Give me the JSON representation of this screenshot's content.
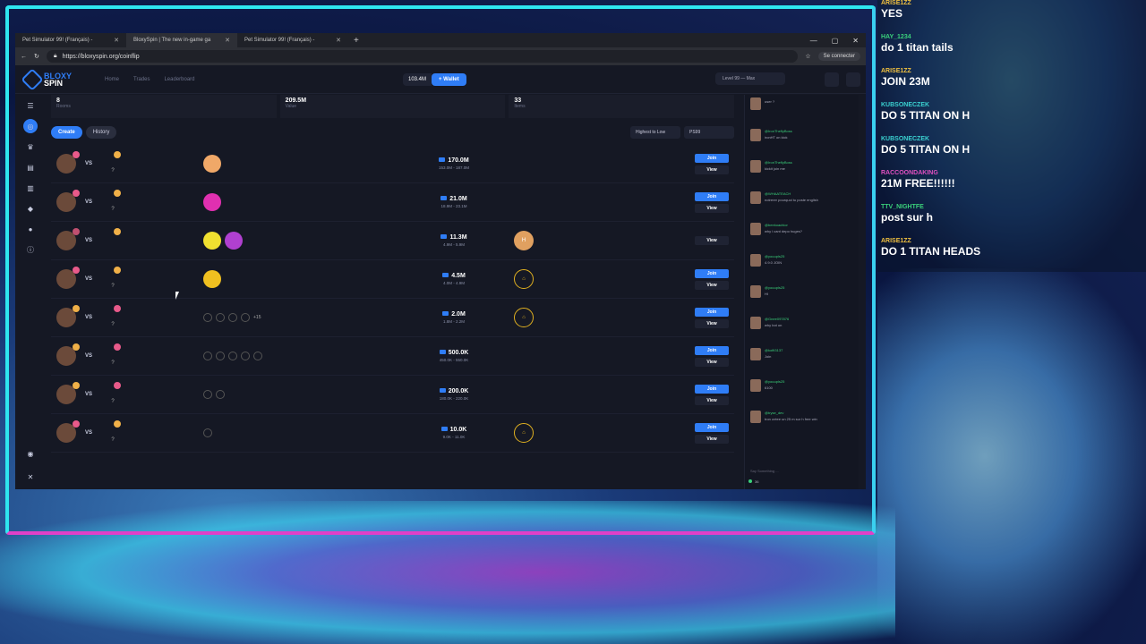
{
  "browser": {
    "tabs": [
      {
        "label": "Pet Simulator 99! (Français) -"
      },
      {
        "label": "BloxySpin | The new in-game ga"
      },
      {
        "label": "Pet Simulator 99! (Français) -"
      }
    ],
    "url": "https://bloxyspin.org/coinflip",
    "signin": "Se connecter"
  },
  "site": {
    "logo_top": "BLOXY",
    "logo_bottom": "SPIN",
    "nav": [
      "Home",
      "Trades",
      "Leaderboard"
    ],
    "balance": "103.4M",
    "wallet": "+ Wallet",
    "user": "Level 99 — Max"
  },
  "stats": [
    {
      "value": "8",
      "label": "Rooms"
    },
    {
      "value": "209.5M",
      "label": "Value"
    },
    {
      "value": "33",
      "label": "Items"
    }
  ],
  "filters": {
    "create": "Create",
    "history": "History",
    "sort": "Highest to Low",
    "game": "PS99"
  },
  "rows": [
    {
      "vs": "VS",
      "qm": "?",
      "value": "170.0M",
      "range": "153.0M - 187.0M",
      "status": "",
      "join": "Join",
      "view": "View",
      "more": "",
      "c1": "#e85a8a",
      "c2": "#f0b048",
      "pets": [
        "#f0a868"
      ],
      "mini": 0
    },
    {
      "vs": "VS",
      "qm": "?",
      "value": "21.0M",
      "range": "18.9M - 23.1M",
      "status": "",
      "join": "Join",
      "view": "View",
      "more": "",
      "c1": "#e85a8a",
      "c2": "#f0b048",
      "pets": [
        "#e030b0"
      ],
      "mini": 0
    },
    {
      "vs": "VS",
      "qm": "",
      "value": "11.3M",
      "range": "4.9M - 5.9M",
      "status": "filled",
      "join": "",
      "view": "View",
      "more": "",
      "c1": "#c05070",
      "c2": "#f0b048",
      "pets": [
        "#f0e030",
        "#b040d0"
      ],
      "mini": 0
    },
    {
      "vs": "VS",
      "qm": "?",
      "value": "4.5M",
      "range": "4.0M - 4.9M",
      "status": "ring",
      "join": "Join",
      "view": "View",
      "more": "",
      "c1": "#e85a8a",
      "c2": "#f0b048",
      "pets": [
        "#f0c020"
      ],
      "mini": 0
    },
    {
      "vs": "VS",
      "qm": "?",
      "value": "2.0M",
      "range": "1.8M - 2.2M",
      "status": "ring",
      "join": "Join",
      "view": "View",
      "more": "+15",
      "c1": "#f0b048",
      "c2": "#e85a8a",
      "pets": [],
      "mini": 4
    },
    {
      "vs": "VS",
      "qm": "?",
      "value": "500.0K",
      "range": "450.0K - 550.0K",
      "status": "",
      "join": "Join",
      "view": "View",
      "more": "",
      "c1": "#f0b048",
      "c2": "#e85a8a",
      "pets": [],
      "mini": 5
    },
    {
      "vs": "VS",
      "qm": "?",
      "value": "200.0K",
      "range": "180.0K - 220.0K",
      "status": "",
      "join": "Join",
      "view": "View",
      "more": "",
      "c1": "#f0b048",
      "c2": "#e85a8a",
      "pets": [],
      "mini": 2
    },
    {
      "vs": "VS",
      "qm": "?",
      "value": "10.0K",
      "range": "9.0K - 11.0K",
      "status": "ring",
      "join": "Join",
      "view": "View",
      "more": "",
      "c1": "#e85a8a",
      "c2": "#f0b048",
      "pets": [],
      "mini": 1
    }
  ],
  "sitechat": {
    "messages": [
      {
        "name": "",
        "text": "user ?"
      },
      {
        "name": "@IronTheflyBoss",
        "text": "ironHT on kick"
      },
      {
        "name": "@IronTheflyBoss",
        "text": "kickit join me"
      },
      {
        "name": "@WHAATEACH",
        "text": "notrerer pourquoi tu poste english"
      },
      {
        "name": "@beekoachior",
        "text": "why i cant depo huges?"
      },
      {
        "name": "@youupls25",
        "text": "4.9.0 JOIN"
      },
      {
        "name": "@youupls25",
        "text": "HI"
      },
      {
        "name": "@Gnee097876",
        "text": "why bot on"
      },
      {
        "name": "@kofit3137",
        "text": "Join"
      },
      {
        "name": "@youupls25",
        "text": "6100"
      },
      {
        "name": "@tryse_dev",
        "text": "tron créee un 25 m sur h free win"
      }
    ],
    "input": "Say Something ...",
    "online": "36"
  },
  "twitch": [
    {
      "user": "ARISE1ZZ",
      "text": "YES",
      "color": "#f0c040"
    },
    {
      "user": "HAY_1234",
      "text": "do 1 titan tails",
      "color": "#3ad07a"
    },
    {
      "user": "ARISE1ZZ",
      "text": "JOIN 23M",
      "color": "#f0c040"
    },
    {
      "user": "KUBSONECZEK",
      "text": "DO 5 TITAN ON H",
      "color": "#3ad0d0"
    },
    {
      "user": "KUBSONECZEK",
      "text": "DO 5 TITAN ON H",
      "color": "#3ad0d0"
    },
    {
      "user": "RACCOONDAKING",
      "text": "21M FREE!!!!!!",
      "color": "#e050c0"
    },
    {
      "user": "TTV_NIGHTFE",
      "text": "post sur h",
      "color": "#3ad07a"
    },
    {
      "user": "ARISE1ZZ",
      "text": "DO 1 TITAN HEADS",
      "color": "#f0c040"
    }
  ]
}
